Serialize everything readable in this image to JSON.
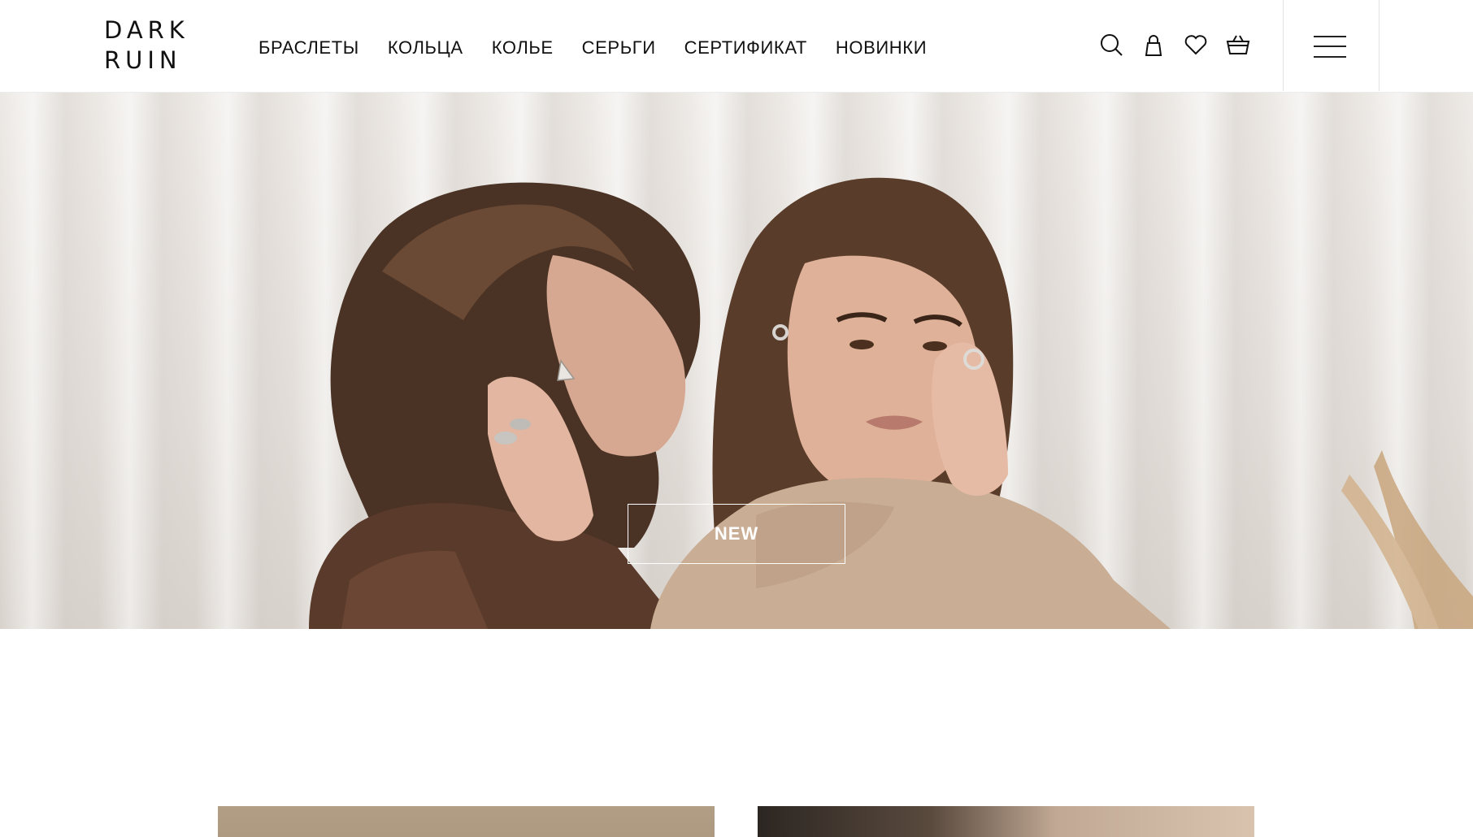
{
  "header": {
    "logo_text_top": "DARK",
    "logo_text_bottom": "RUIN",
    "nav": [
      {
        "label": "БРАСЛЕТЫ"
      },
      {
        "label": "КОЛЬЦА"
      },
      {
        "label": "КОЛЬЕ"
      },
      {
        "label": "СЕРЬГИ"
      },
      {
        "label": "СЕРТИФИКАТ"
      },
      {
        "label": "НОВИНКИ"
      }
    ],
    "icons": [
      "search-icon",
      "account-icon",
      "wishlist-heart-icon",
      "cart-basket-icon"
    ],
    "menu_icon": "hamburger-menu-icon"
  },
  "hero": {
    "cta_label": "NEW"
  },
  "colors": {
    "text": "#111111",
    "header_bg": "#ffffff",
    "hero_bg": "#e6e1dc",
    "cta_border": "#ffffff",
    "card_left": "#b19e85"
  }
}
